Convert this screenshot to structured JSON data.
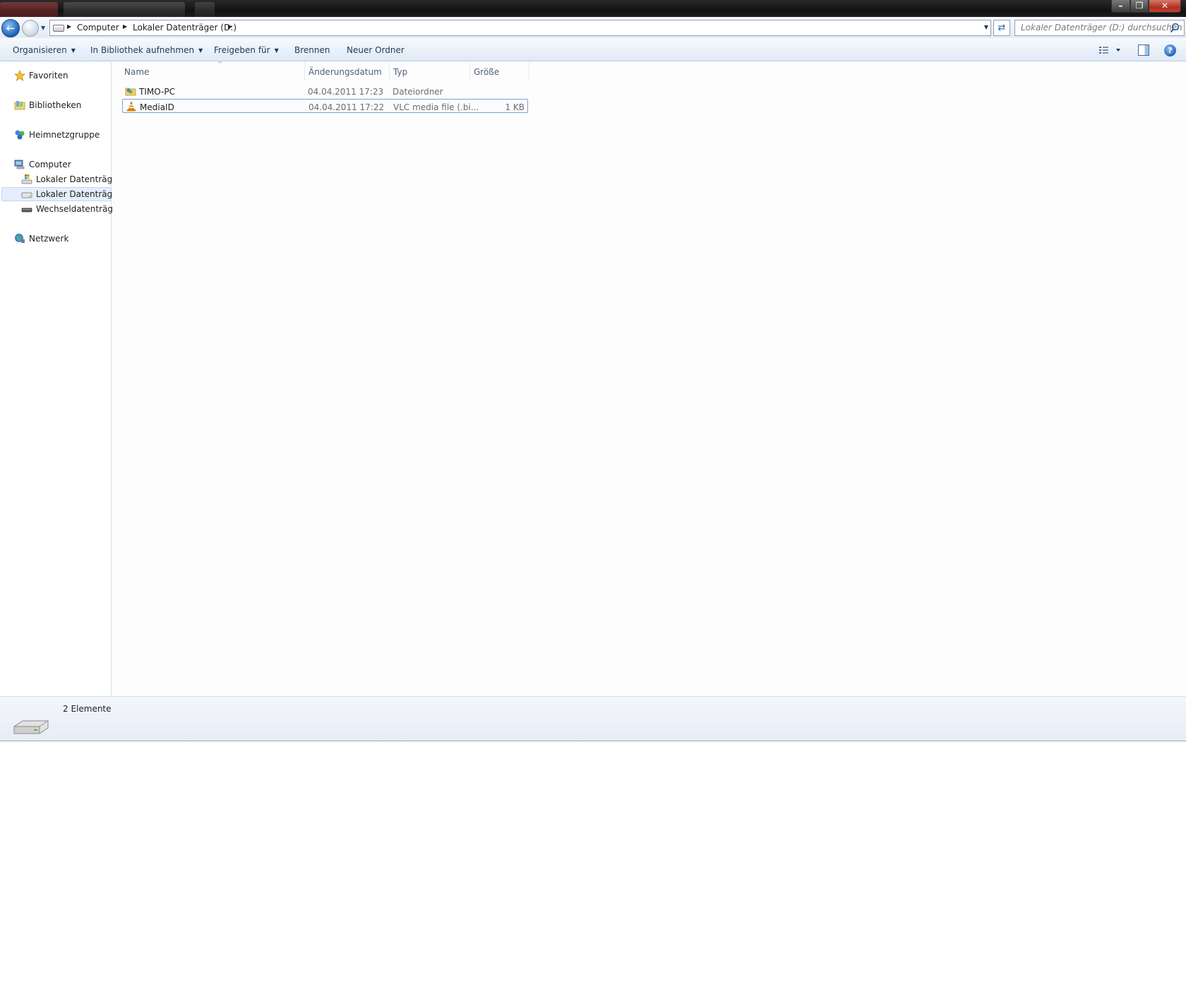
{
  "titlebar": {
    "minimize": "–",
    "maximize": "❐",
    "close": "✕"
  },
  "address": {
    "crumbs": [
      "Computer",
      "Lokaler Datenträger (D:)"
    ],
    "search_placeholder": "Lokaler Datenträger (D:) durchsuchen"
  },
  "commands": {
    "organize": "Organisieren",
    "library": "In Bibliothek aufnehmen",
    "share": "Freigeben für",
    "burn": "Brennen",
    "new_folder": "Neuer Ordner"
  },
  "nav": {
    "favorites": "Favoriten",
    "libraries": "Bibliotheken",
    "homegroup": "Heimnetzgruppe",
    "computer": "Computer",
    "drive_c": "Lokaler Datenträger",
    "drive_d": "Lokaler Datenträger",
    "removable": "Wechseldatenträger",
    "network": "Netzwerk"
  },
  "columns": {
    "name": "Name",
    "date": "Änderungsdatum",
    "type": "Typ",
    "size": "Größe"
  },
  "files": [
    {
      "name": "TIMO-PC",
      "date": "04.04.2011 17:23",
      "type": "Dateiordner",
      "size": "",
      "icon": "shared-folder-icon"
    },
    {
      "name": "MediaID",
      "date": "04.04.2011 17:22",
      "type": "VLC media file (.bi...",
      "size": "1 KB",
      "icon": "vlc-cone-icon"
    }
  ],
  "details": {
    "count": "2 Elemente"
  },
  "colors": {
    "accent": "#1b5fb8",
    "selection_border": "#7da2ce",
    "command_text": "#1e395b"
  }
}
